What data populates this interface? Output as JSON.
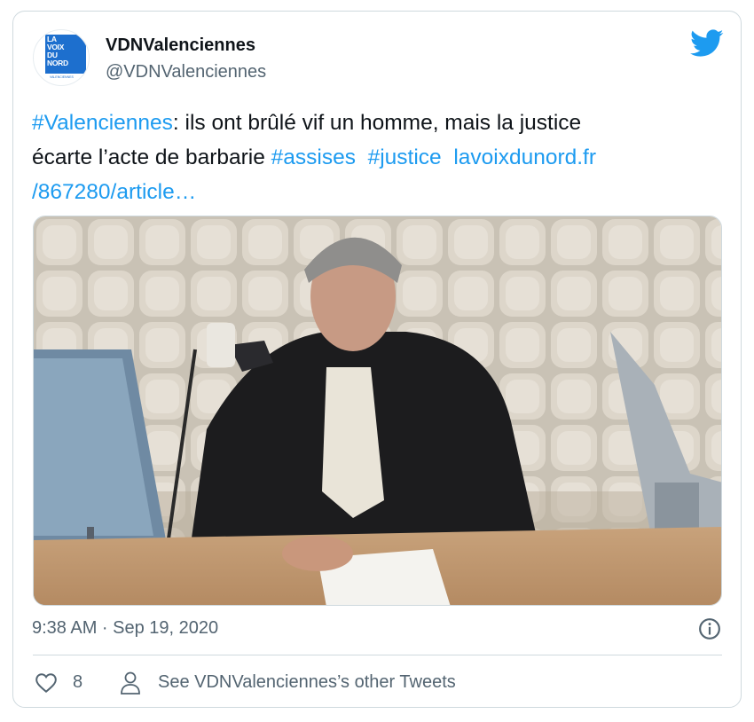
{
  "author": {
    "name": "VDNValenciennes",
    "handle": "@VDNValenciennes",
    "avatar_logo_lines": [
      "LA",
      "VOIX",
      "DU",
      "NORD"
    ],
    "avatar_logo_sub": "VALENCIENNES",
    "logo_color": "#1d6fce"
  },
  "tweet": {
    "lines": [
      [
        {
          "text": "#Valenciennes",
          "link": true
        },
        {
          "text": ": ils ont brûlé vif un homme, mais la justice",
          "link": false
        }
      ],
      [
        {
          "text": "écarte l’acte de barbarie ",
          "link": false
        },
        {
          "text": " #assises",
          "link": true
        },
        {
          "text": "  ",
          "link": false
        },
        {
          "text": "#justice",
          "link": true
        },
        {
          "text": "  ",
          "link": false
        },
        {
          "text": "lavoixdunord.fr",
          "link": true
        }
      ],
      [
        {
          "text": "/867280/article…",
          "link": true
        }
      ]
    ]
  },
  "timestamp": "9:38 AM · Sep 19, 2020",
  "actions": {
    "likes": "8",
    "other_tweets_label": "See VDNValenciennes’s other Tweets"
  },
  "icons": {
    "brand": "twitter-bird-icon",
    "info": "info-icon",
    "like": "heart-icon",
    "profile": "person-icon"
  },
  "colors": {
    "link": "#1d9bf0",
    "secondary_text": "#536471",
    "border": "#cfd9de"
  }
}
